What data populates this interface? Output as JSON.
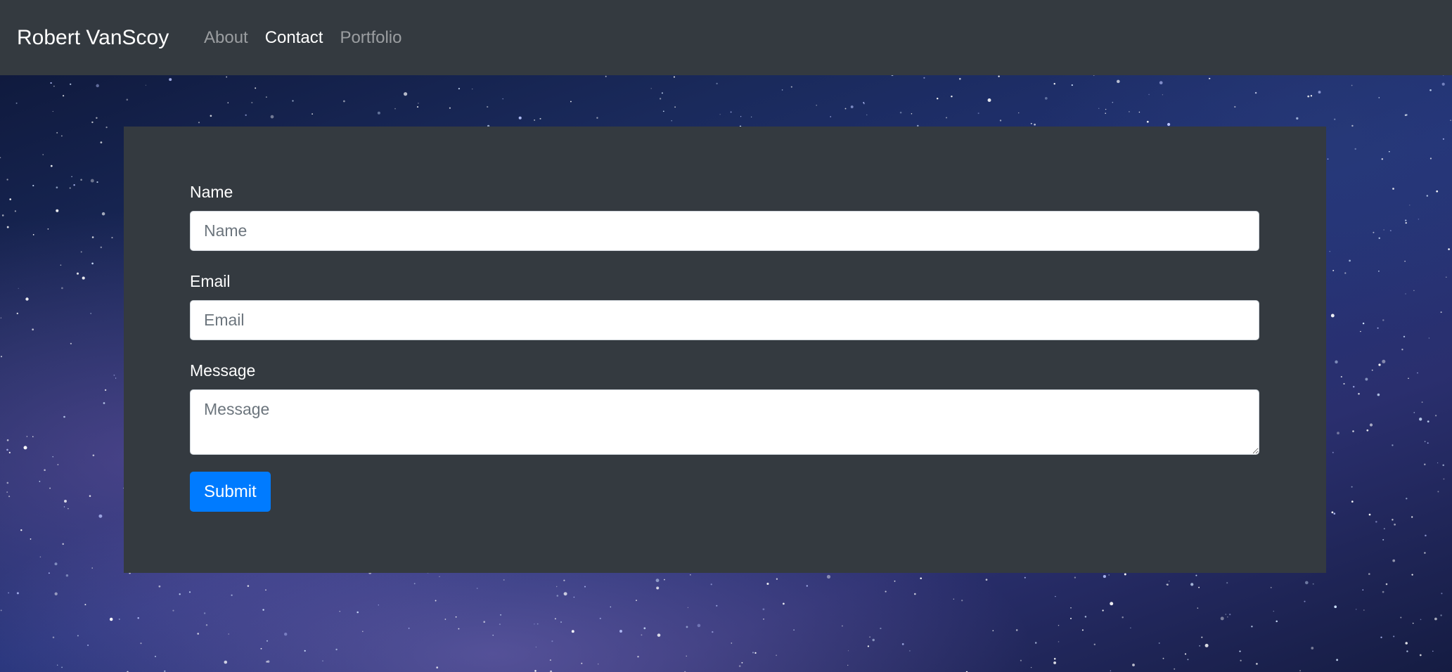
{
  "navbar": {
    "brand": "Robert VanScoy",
    "links": [
      {
        "label": "About",
        "active": false
      },
      {
        "label": "Contact",
        "active": true
      },
      {
        "label": "Portfolio",
        "active": false
      }
    ]
  },
  "form": {
    "name": {
      "label": "Name",
      "placeholder": "Name",
      "value": ""
    },
    "email": {
      "label": "Email",
      "placeholder": "Email",
      "value": ""
    },
    "message": {
      "label": "Message",
      "placeholder": "Message",
      "value": ""
    },
    "submit_label": "Submit"
  },
  "colors": {
    "navbar_bg": "#343a40",
    "card_bg": "#343a40",
    "primary_button": "#007bff",
    "nav_active": "#ffffff",
    "nav_inactive": "rgba(255,255,255,0.5)"
  }
}
